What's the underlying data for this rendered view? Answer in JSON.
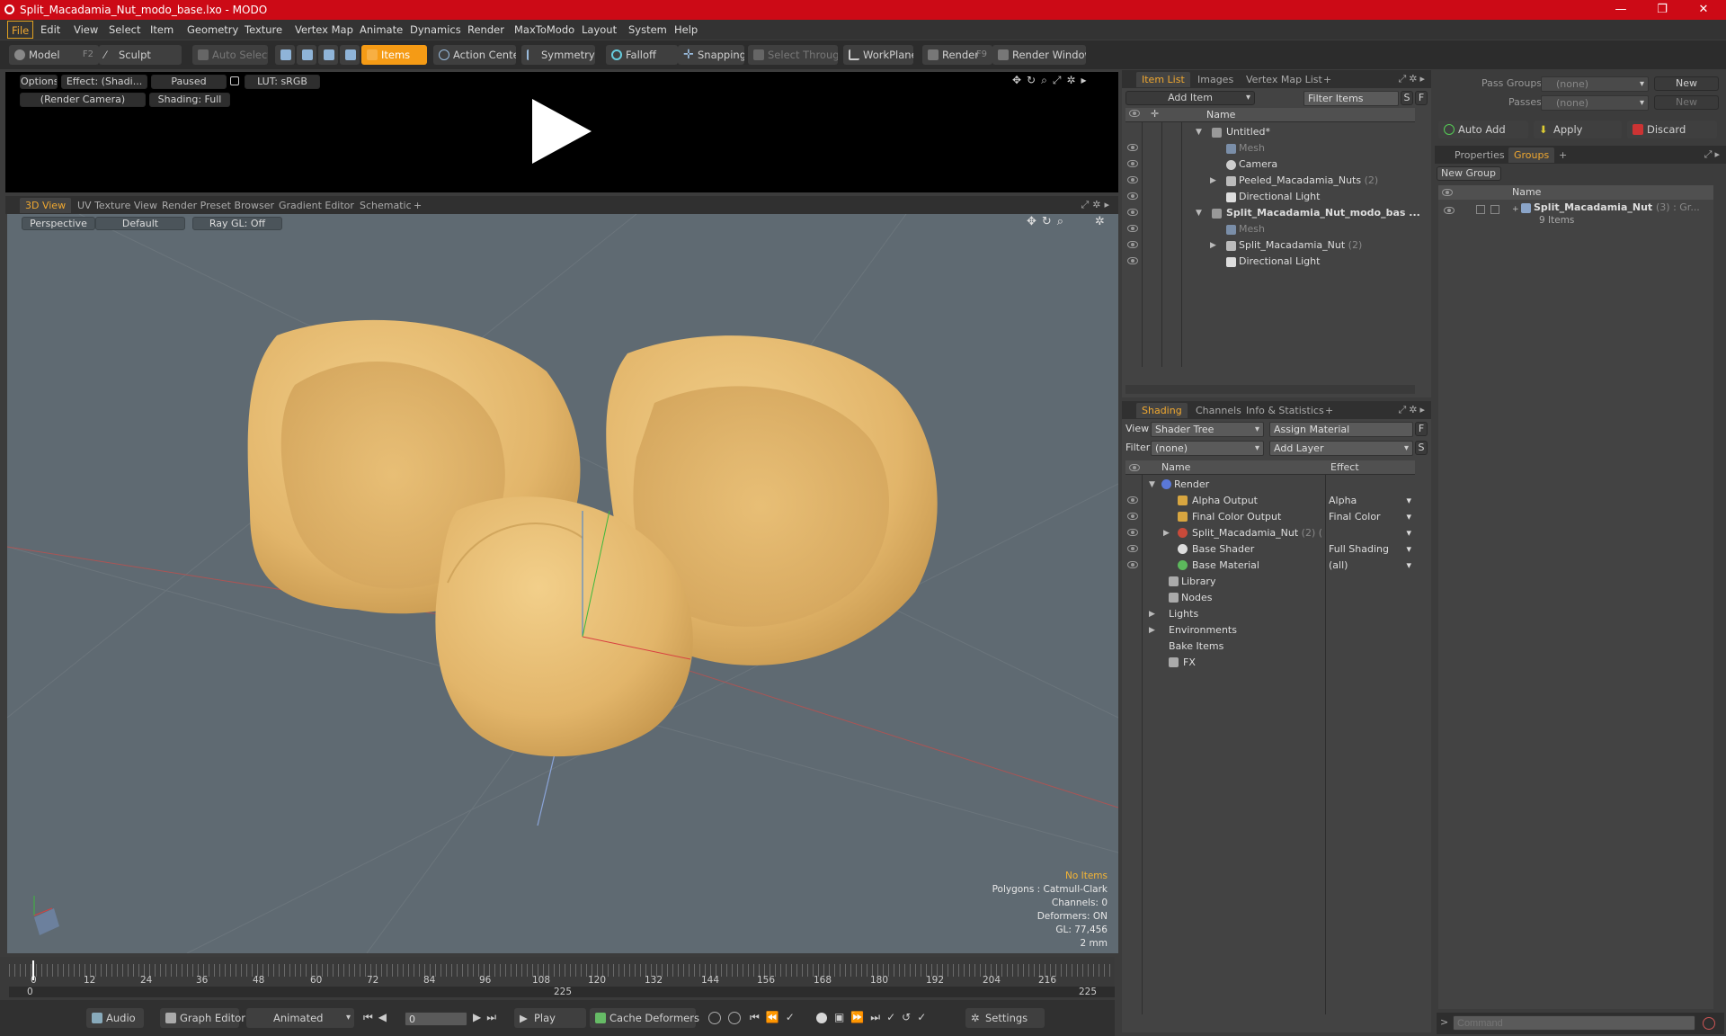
{
  "window": {
    "title": "Split_Macadamia_Nut_modo_base.lxo - MODO",
    "minimize": "—",
    "maximize": "❐",
    "close": "✕"
  },
  "menu": [
    "File",
    "Edit",
    "View",
    "Select",
    "Item",
    "Geometry",
    "Texture",
    "Vertex Map",
    "Animate",
    "Dynamics",
    "Render",
    "MaxToModo",
    "Layout",
    "System",
    "Help"
  ],
  "toolbar": {
    "model": "Model",
    "model_key": "F2",
    "sculpt": "Sculpt",
    "auto_select": "Auto Select",
    "items": "Items",
    "action_center": "Action Center",
    "symmetry": "Symmetry",
    "falloff": "Falloff",
    "snapping": "Snapping",
    "select_through": "Select Through",
    "workplane": "WorkPlane",
    "render": "Render",
    "render_key": "F9",
    "render_window": "Render Window"
  },
  "preview": {
    "options": "Options",
    "effect": "Effect: (Shadi...",
    "paused": "Paused",
    "lut": "LUT: sRGB",
    "camera": "(Render Camera)",
    "shading": "Shading: Full"
  },
  "view_tabs": [
    "3D View",
    "UV Texture View",
    "Render Preset Browser",
    "Gradient Editor",
    "Schematic",
    "+"
  ],
  "viewport": {
    "perspective": "Perspective",
    "default": "Default",
    "raygl": "Ray GL: Off",
    "stats": {
      "no_items": "No Items",
      "polygons": "Polygons : Catmull-Clark",
      "channels": "Channels: 0",
      "deformers": "Deformers: ON",
      "gl": "GL: 77,456",
      "scale": "2 mm"
    }
  },
  "timeline": {
    "ticks": [
      "0",
      "12",
      "24",
      "36",
      "48",
      "60",
      "72",
      "84",
      "96",
      "108",
      "120",
      "132",
      "144",
      "156",
      "168",
      "180",
      "192",
      "204",
      "216"
    ],
    "start": "0",
    "mid": "225",
    "end": "225"
  },
  "bottom": {
    "audio": "Audio",
    "graph_editor": "Graph Editor",
    "animated": "Animated",
    "frame": "0",
    "play": "Play",
    "cache": "Cache Deformers",
    "settings": "Settings"
  },
  "item_list": {
    "tabs": [
      "Item List",
      "Images",
      "Vertex Map List",
      "+"
    ],
    "add_item": "Add Item",
    "filter": "Filter Items",
    "s": "S",
    "f": "F",
    "col_name": "Name",
    "rows": [
      {
        "label": "Untitled*",
        "suffix": "",
        "dim": false,
        "bold": false
      },
      {
        "label": "Mesh",
        "suffix": "",
        "dim": true,
        "bold": false
      },
      {
        "label": "Camera",
        "suffix": "",
        "dim": false,
        "bold": false
      },
      {
        "label": "Peeled_Macadamia_Nuts",
        "suffix": "(2)",
        "dim": false,
        "bold": false
      },
      {
        "label": "Directional Light",
        "suffix": "",
        "dim": false,
        "bold": false
      },
      {
        "label": "Split_Macadamia_Nut_modo_bas ...",
        "suffix": "",
        "dim": false,
        "bold": true
      },
      {
        "label": "Mesh",
        "suffix": "",
        "dim": true,
        "bold": false
      },
      {
        "label": "Split_Macadamia_Nut",
        "suffix": "(2)",
        "dim": false,
        "bold": false
      },
      {
        "label": "Directional Light",
        "suffix": "",
        "dim": false,
        "bold": false
      }
    ]
  },
  "shading": {
    "tabs": [
      "Shading",
      "Channels",
      "Info & Statistics",
      "+"
    ],
    "view_label": "View",
    "view_value": "Shader Tree",
    "assign": "Assign Material",
    "f": "F",
    "filter_label": "Filter",
    "filter_value": "(none)",
    "add_layer": "Add Layer",
    "s": "S",
    "col_name": "Name",
    "col_effect": "Effect",
    "rows": [
      {
        "label": "Render",
        "suffix": "",
        "effect": ""
      },
      {
        "label": "Alpha Output",
        "suffix": "",
        "effect": "Alpha"
      },
      {
        "label": "Final Color Output",
        "suffix": "",
        "effect": "Final Color"
      },
      {
        "label": "Split_Macadamia_Nut",
        "suffix": "(2) ( ...",
        "effect": ""
      },
      {
        "label": "Base Shader",
        "suffix": "",
        "effect": "Full Shading"
      },
      {
        "label": "Base Material",
        "suffix": "",
        "effect": "(all)"
      },
      {
        "label": "Library",
        "suffix": "",
        "effect": ""
      },
      {
        "label": "Nodes",
        "suffix": "",
        "effect": ""
      },
      {
        "label": "Lights",
        "suffix": "",
        "effect": ""
      },
      {
        "label": "Environments",
        "suffix": "",
        "effect": ""
      },
      {
        "label": "Bake Items",
        "suffix": "",
        "effect": ""
      },
      {
        "label": "FX",
        "suffix": "",
        "effect": ""
      }
    ]
  },
  "groups": {
    "pass_groups": "Pass Groups",
    "passes": "Passes",
    "none": "(none)",
    "new": "New",
    "auto_add": "Auto Add",
    "apply": "Apply",
    "discard": "Discard",
    "tabs": [
      "Properties",
      "Groups",
      "+"
    ],
    "new_group": "New Group",
    "col_name": "Name",
    "group_name": "Split_Macadamia_Nut",
    "group_suffix": "(3) : Gr...",
    "group_items": "9 Items"
  },
  "command": {
    "placeholder": "Command"
  },
  "colors": {
    "accent": "#f59b15",
    "titlebar": "#cc0a16",
    "nut": "#e8bd72"
  }
}
